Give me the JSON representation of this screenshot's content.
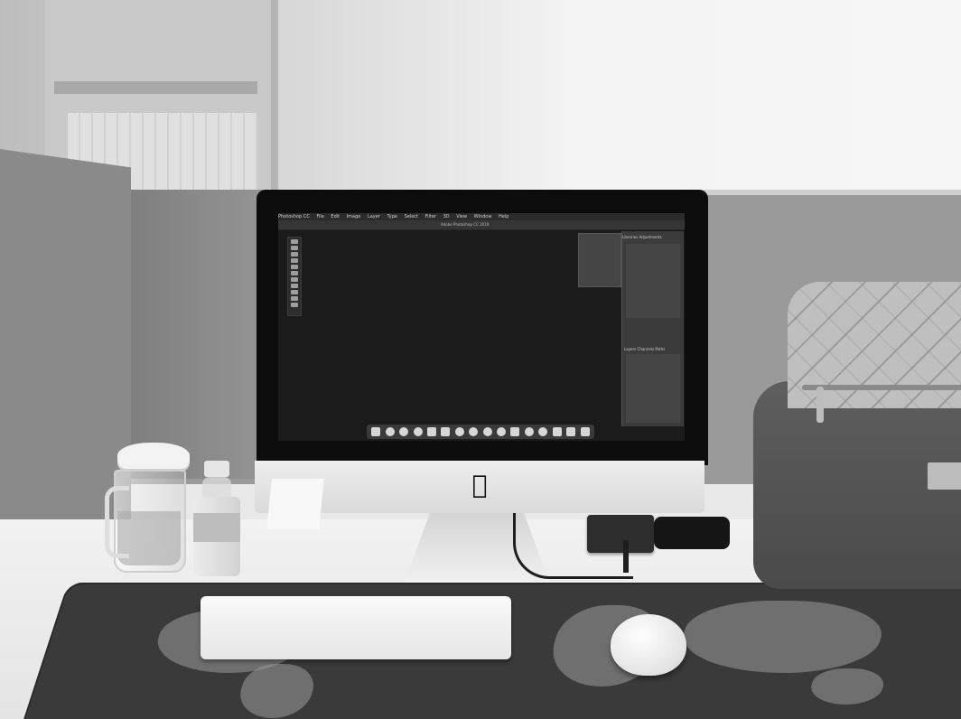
{
  "screen": {
    "app_menu": [
      "Photoshop CC",
      "File",
      "Edit",
      "Image",
      "Layer",
      "Type",
      "Select",
      "Filter",
      "3D",
      "View",
      "Window",
      "Help"
    ],
    "document_title": "Adobe Photoshop CC 2019",
    "panel_tabs": [
      "Libraries",
      "Adjustments"
    ],
    "panel_tabs_lower": [
      "Layers",
      "Channels",
      "Paths"
    ]
  },
  "icons": {
    "computer_logo": "apple-logo-icon"
  },
  "colors": {
    "scene": "#9a9a9a",
    "screen": "#1b1b1b",
    "mousepad": "#3a3a3a"
  }
}
